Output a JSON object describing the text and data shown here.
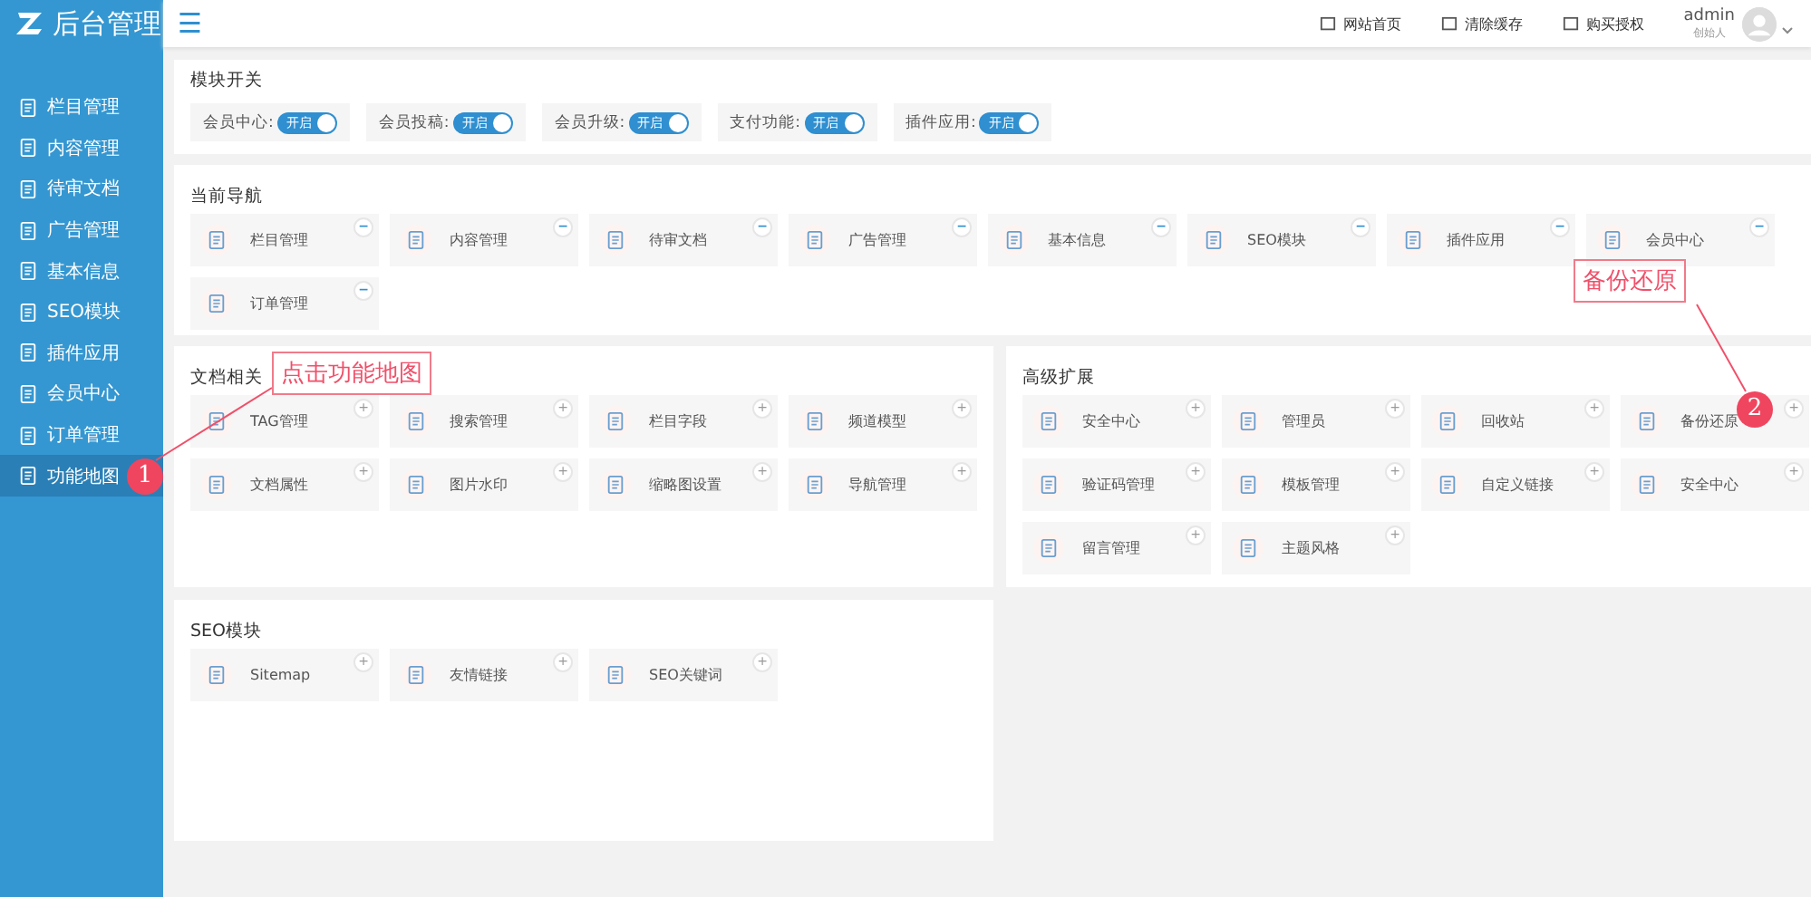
{
  "sidebar": {
    "logo": "后台管理",
    "items": [
      {
        "label": "栏目管理",
        "selected": false
      },
      {
        "label": "内容管理",
        "selected": false
      },
      {
        "label": "待审文档",
        "selected": false
      },
      {
        "label": "广告管理",
        "selected": false
      },
      {
        "label": "基本信息",
        "selected": false
      },
      {
        "label": "SEO模块",
        "selected": false
      },
      {
        "label": "插件应用",
        "selected": false
      },
      {
        "label": "会员中心",
        "selected": false
      },
      {
        "label": "订单管理",
        "selected": false
      },
      {
        "label": "功能地图",
        "selected": true
      }
    ]
  },
  "header": {
    "menu_icon": "☰",
    "links": [
      "网站首页",
      "清除缓存",
      "购买授权"
    ],
    "user": {
      "name": "admin",
      "role": "创始人"
    }
  },
  "switches": {
    "title": "模块开关",
    "items": [
      {
        "label": "会员中心:",
        "state_text": "开启",
        "on": true
      },
      {
        "label": "会员投稿:",
        "state_text": "开启",
        "on": true
      },
      {
        "label": "会员升级:",
        "state_text": "开启",
        "on": true
      },
      {
        "label": "支付功能:",
        "state_text": "开启",
        "on": true
      },
      {
        "label": "插件应用:",
        "state_text": "开启",
        "on": true
      }
    ]
  },
  "current_nav": {
    "title": "当前导航",
    "badge": "−",
    "cards": [
      "栏目管理",
      "内容管理",
      "待审文档",
      "广告管理",
      "基本信息",
      "SEO模块",
      "插件应用",
      "会员中心",
      "订单管理"
    ]
  },
  "docs": {
    "title": "文档相关",
    "badge": "+",
    "cards": [
      "TAG管理",
      "搜索管理",
      "栏目字段",
      "频道模型",
      "文档属性",
      "图片水印",
      "缩略图设置",
      "导航管理"
    ]
  },
  "advanced": {
    "title": "高级扩展",
    "badge": "+",
    "cards": [
      "安全中心",
      "管理员",
      "回收站",
      "备份还原",
      "验证码管理",
      "模板管理",
      "自定义链接",
      "安全中心",
      "留言管理",
      "主题风格"
    ]
  },
  "seo": {
    "title": "SEO模块",
    "badge": "+",
    "cards": [
      "Sitemap",
      "友情链接",
      "SEO关键词"
    ]
  },
  "annotations": [
    {
      "text": "点击功能地图",
      "number": "1"
    },
    {
      "text": "备份还原",
      "number": "2"
    }
  ]
}
